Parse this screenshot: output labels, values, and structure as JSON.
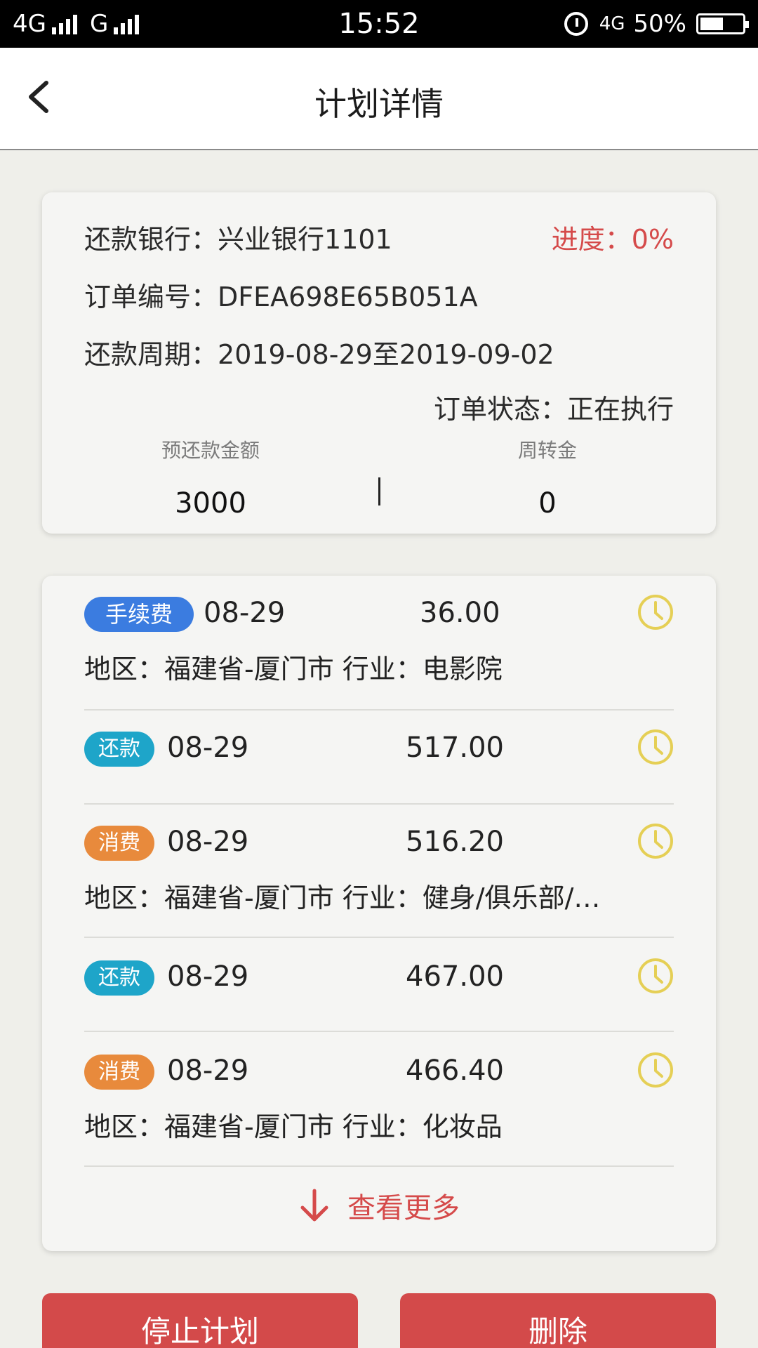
{
  "status_bar": {
    "left": "4G",
    "left2": "G",
    "time": "15:52",
    "network": "4G",
    "battery": "50%"
  },
  "header": {
    "title": "计划详情"
  },
  "info": {
    "bank_label": "还款银行：",
    "bank_value": "兴业银行1101",
    "progress_label": "进度：",
    "progress_value": "0%",
    "order_label": "订单编号：",
    "order_value": "DFEA698E65B051A",
    "period_label": "还款周期：",
    "period_value": "2019-08-29至2019-09-02",
    "status_label": "订单状态：",
    "status_value": "正在执行",
    "prepay_label": "预还款金额",
    "prepay_value": "3000",
    "turnover_label": "周转金",
    "turnover_value": "0"
  },
  "records": [
    {
      "tag": "手续费",
      "date": "08-29",
      "amount": "36.00",
      "detail": "地区：福建省-厦门市  行业：电影院"
    },
    {
      "tag": "还款",
      "date": "08-29",
      "amount": "517.00",
      "detail": ""
    },
    {
      "tag": "消费",
      "date": "08-29",
      "amount": "516.20",
      "detail": "地区：福建省-厦门市  行业：健身/俱乐部/…"
    },
    {
      "tag": "还款",
      "date": "08-29",
      "amount": "467.00",
      "detail": ""
    },
    {
      "tag": "消费",
      "date": "08-29",
      "amount": "466.40",
      "detail": "地区：福建省-厦门市  行业：化妆品"
    }
  ],
  "more_label": "查看更多",
  "buttons": {
    "stop": "停止计划",
    "delete": "删除"
  },
  "colors": {
    "accent_red": "#d34a4a",
    "tag_fee": "#3b7ce0",
    "tag_repay": "#1ea5c9",
    "tag_spend": "#e88a3c",
    "clock": "#e5cf55"
  },
  "icons": {
    "back": "chevron-left-icon",
    "clock": "clock-icon",
    "more": "arrow-down-icon"
  }
}
